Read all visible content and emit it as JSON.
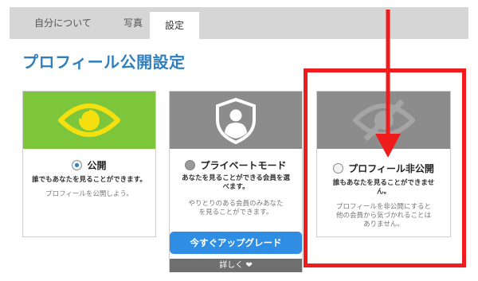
{
  "tabs": [
    {
      "label": "自分について"
    },
    {
      "label": "写真"
    },
    {
      "label": "設定"
    }
  ],
  "active_tab": "設定",
  "page_title": "プロフィール公開設定",
  "cards": [
    {
      "option": "公開",
      "selected": true,
      "desc_bold": "誰でもあなたを見ることができます。",
      "desc": "プロフィールを公開しよう。",
      "icon": "eye-icon"
    },
    {
      "option": "プライベートモード",
      "selected": false,
      "desc_bold_1": "あなたを見ることができる会員を選",
      "desc_bold_2": "べます。",
      "desc_1": "やりとりのある会員のみあなた",
      "desc_2": "を見ることができます。",
      "upgrade_label": "今すぐアップグレード",
      "details_label": "詳しく ❤",
      "icon": "shield-user-icon"
    },
    {
      "option": "プロフィール非公開",
      "selected": false,
      "desc_bold_1": "誰もあなたを見ることができませ",
      "desc_bold_2": "ん。",
      "desc_1": "プロフィールを非公開にすると",
      "desc_2": "他の会員から気づかれることは",
      "desc_3": "ありません。",
      "icon": "eye-slash-icon"
    }
  ],
  "colors": {
    "title": "#2f7fbe",
    "public_hero": "#7dc63c",
    "eye_icon": "#f5e00f",
    "gray_hero": "#8c8c8c",
    "upgrade_button": "#2f8de4",
    "annotation": "#ee1c1c"
  }
}
